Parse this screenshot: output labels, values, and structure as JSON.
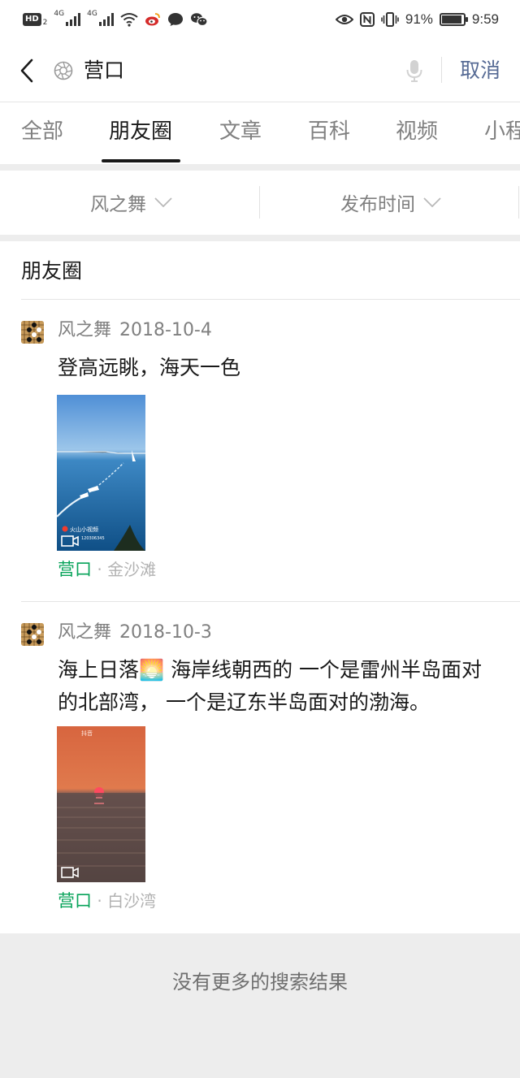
{
  "status_bar": {
    "hd_label": "HD",
    "hd_sub": "2",
    "net1": "4G",
    "net2": "4G",
    "battery_text": "91%",
    "battery_level": 0.91,
    "time": "9:59"
  },
  "search": {
    "query": "营口",
    "cancel_label": "取消"
  },
  "tabs": [
    {
      "label": "全部"
    },
    {
      "label": "朋友圈"
    },
    {
      "label": "文章"
    },
    {
      "label": "百科"
    },
    {
      "label": "视频"
    },
    {
      "label": "小程"
    }
  ],
  "active_tab": "朋友圈",
  "filters": {
    "author": "风之舞",
    "time": "发布时间"
  },
  "section_title": "朋友圈",
  "posts": [
    {
      "author": "风之舞",
      "date": "2018-10-4",
      "text": "登高远眺，海天一色",
      "video_watermark": "火山小视频",
      "video_id": "120306345",
      "location_main": "营口",
      "location_sub": "· 金沙滩"
    },
    {
      "author": "风之舞",
      "date": "2018-10-3",
      "text": "海上日落🌅 海岸线朝西的 一个是雷州半岛面对的北部湾， 一个是辽东半岛面对的渤海。",
      "video_watermark": "抖音",
      "location_main": "营口",
      "location_sub": "· 白沙湾"
    }
  ],
  "no_more_text": "没有更多的搜索结果",
  "colors": {
    "accent_link": "#576b95",
    "location_green": "#07a35a",
    "background": "#ededed"
  }
}
